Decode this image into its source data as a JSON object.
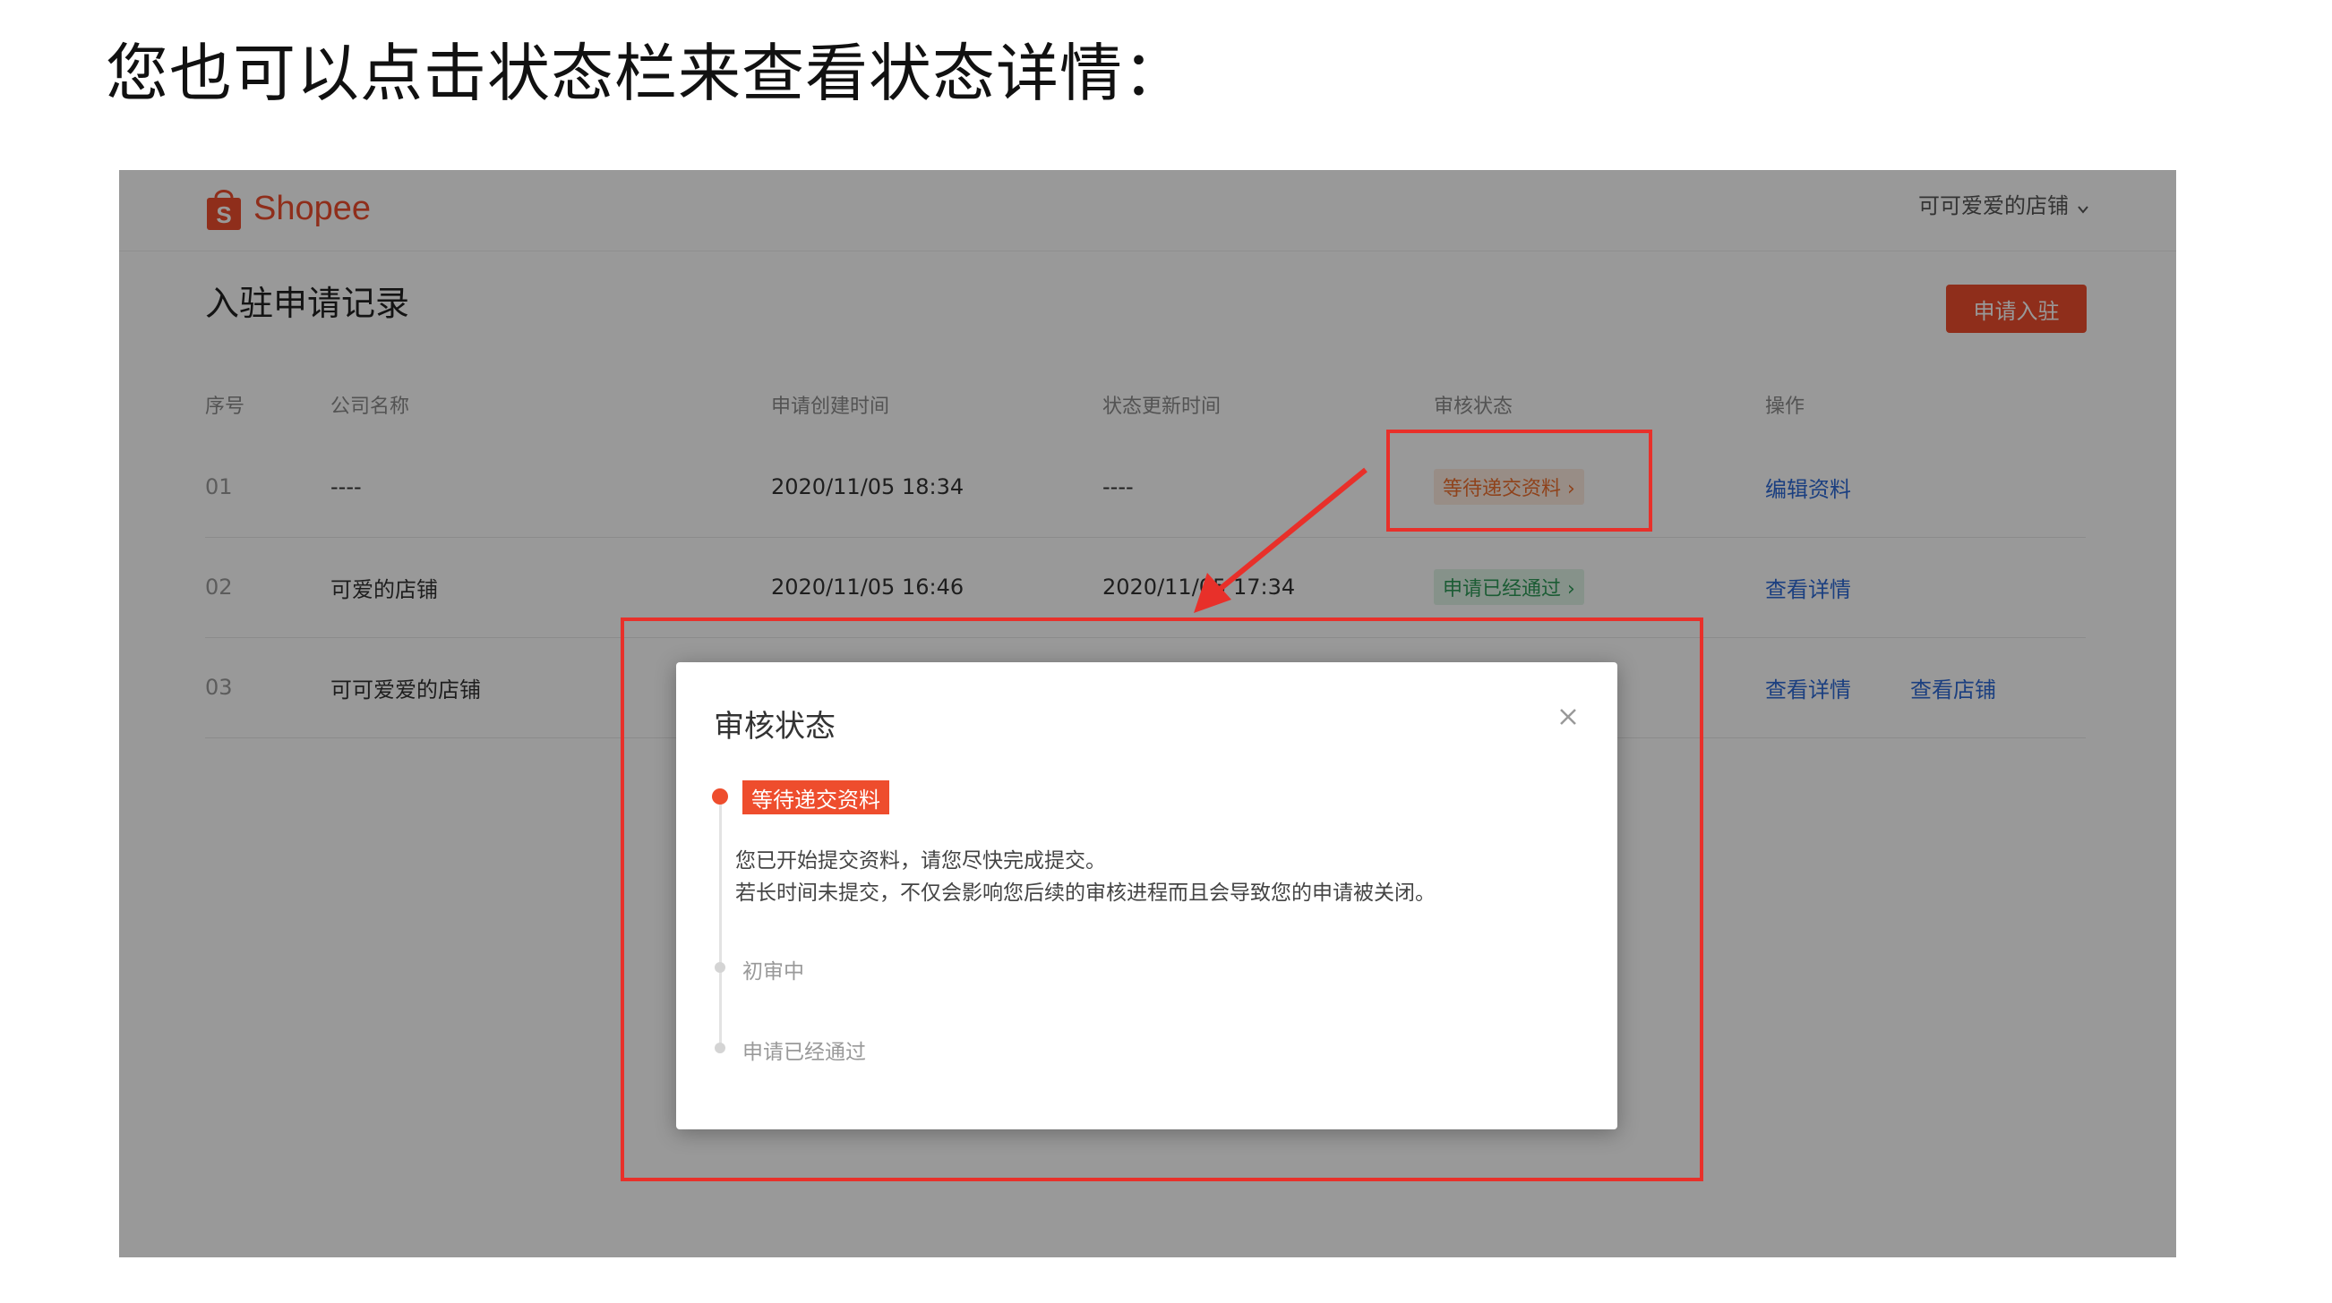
{
  "caption": "您也可以点击状态栏来查看状态详情：",
  "header": {
    "logo_text": "Shopee",
    "shop_name": "可可爱爱的店铺",
    "brand_color": "#ee4d2d"
  },
  "page": {
    "title": "入驻申请记录",
    "apply_button": "申请入驻"
  },
  "table": {
    "columns": [
      "序号",
      "公司名称",
      "申请创建时间",
      "状态更新时间",
      "审核状态",
      "操作"
    ],
    "rows": [
      {
        "idx": "01",
        "company": "----",
        "created": "2020/11/05 18:34",
        "updated": "----",
        "status": "等待递交资料 ›",
        "action1": "编辑资料",
        "action2": ""
      },
      {
        "idx": "02",
        "company": "可爱的店铺",
        "created": "2020/11/05 16:46",
        "updated": "2020/11/05 17:34",
        "status": "申请已经通过 ›",
        "action1": "查看详情",
        "action2": ""
      },
      {
        "idx": "03",
        "company": "可可爱爱的店铺",
        "created": "",
        "updated": "",
        "status": "",
        "action1": "查看详情",
        "action2": "查看店铺"
      }
    ]
  },
  "modal": {
    "title": "审核状态",
    "active_step": "等待递交资料",
    "desc_line1": "您已开始提交资料，请您尽快完成提交。",
    "desc_line2": "若长时间未提交，不仅会影响您后续的审核进程而且会导致您的申请被关闭。",
    "step2": "初审中",
    "step3": "申请已经通过"
  },
  "icons": {
    "logo": "shopee-bag-icon",
    "dropdown": "chevron-down-icon",
    "close": "close-icon"
  },
  "highlight_color": "#e8302a"
}
